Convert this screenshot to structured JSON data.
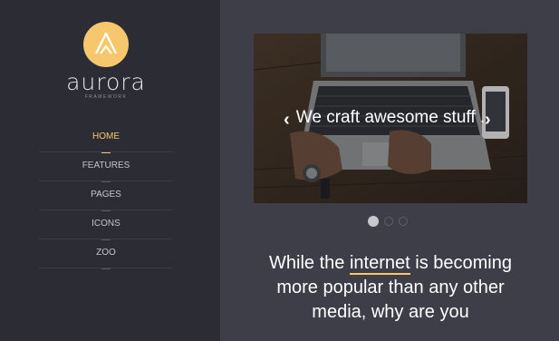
{
  "brand": {
    "name": "aurora",
    "subtitle": "FRAMEWORK"
  },
  "nav": {
    "items": [
      {
        "label": "HOME",
        "active": true
      },
      {
        "label": "FEATURES",
        "active": false
      },
      {
        "label": "PAGES",
        "active": false
      },
      {
        "label": "ICONS",
        "active": false
      },
      {
        "label": "ZOO",
        "active": false
      }
    ]
  },
  "slider": {
    "caption": "We craft awesome stuff .",
    "prev_icon": "chevron-left-icon",
    "next_icon": "chevron-right-icon",
    "prev_glyph": "‹",
    "next_glyph": "›",
    "slide_count": 3,
    "active_slide": 1
  },
  "intro": {
    "before": "While the ",
    "highlight": "internet",
    "after": " is becoming more popular than any other media, why are you"
  },
  "colors": {
    "accent": "#f6c76c",
    "sidebar_bg": "#2c2d34",
    "main_bg": "#3d3e48"
  }
}
